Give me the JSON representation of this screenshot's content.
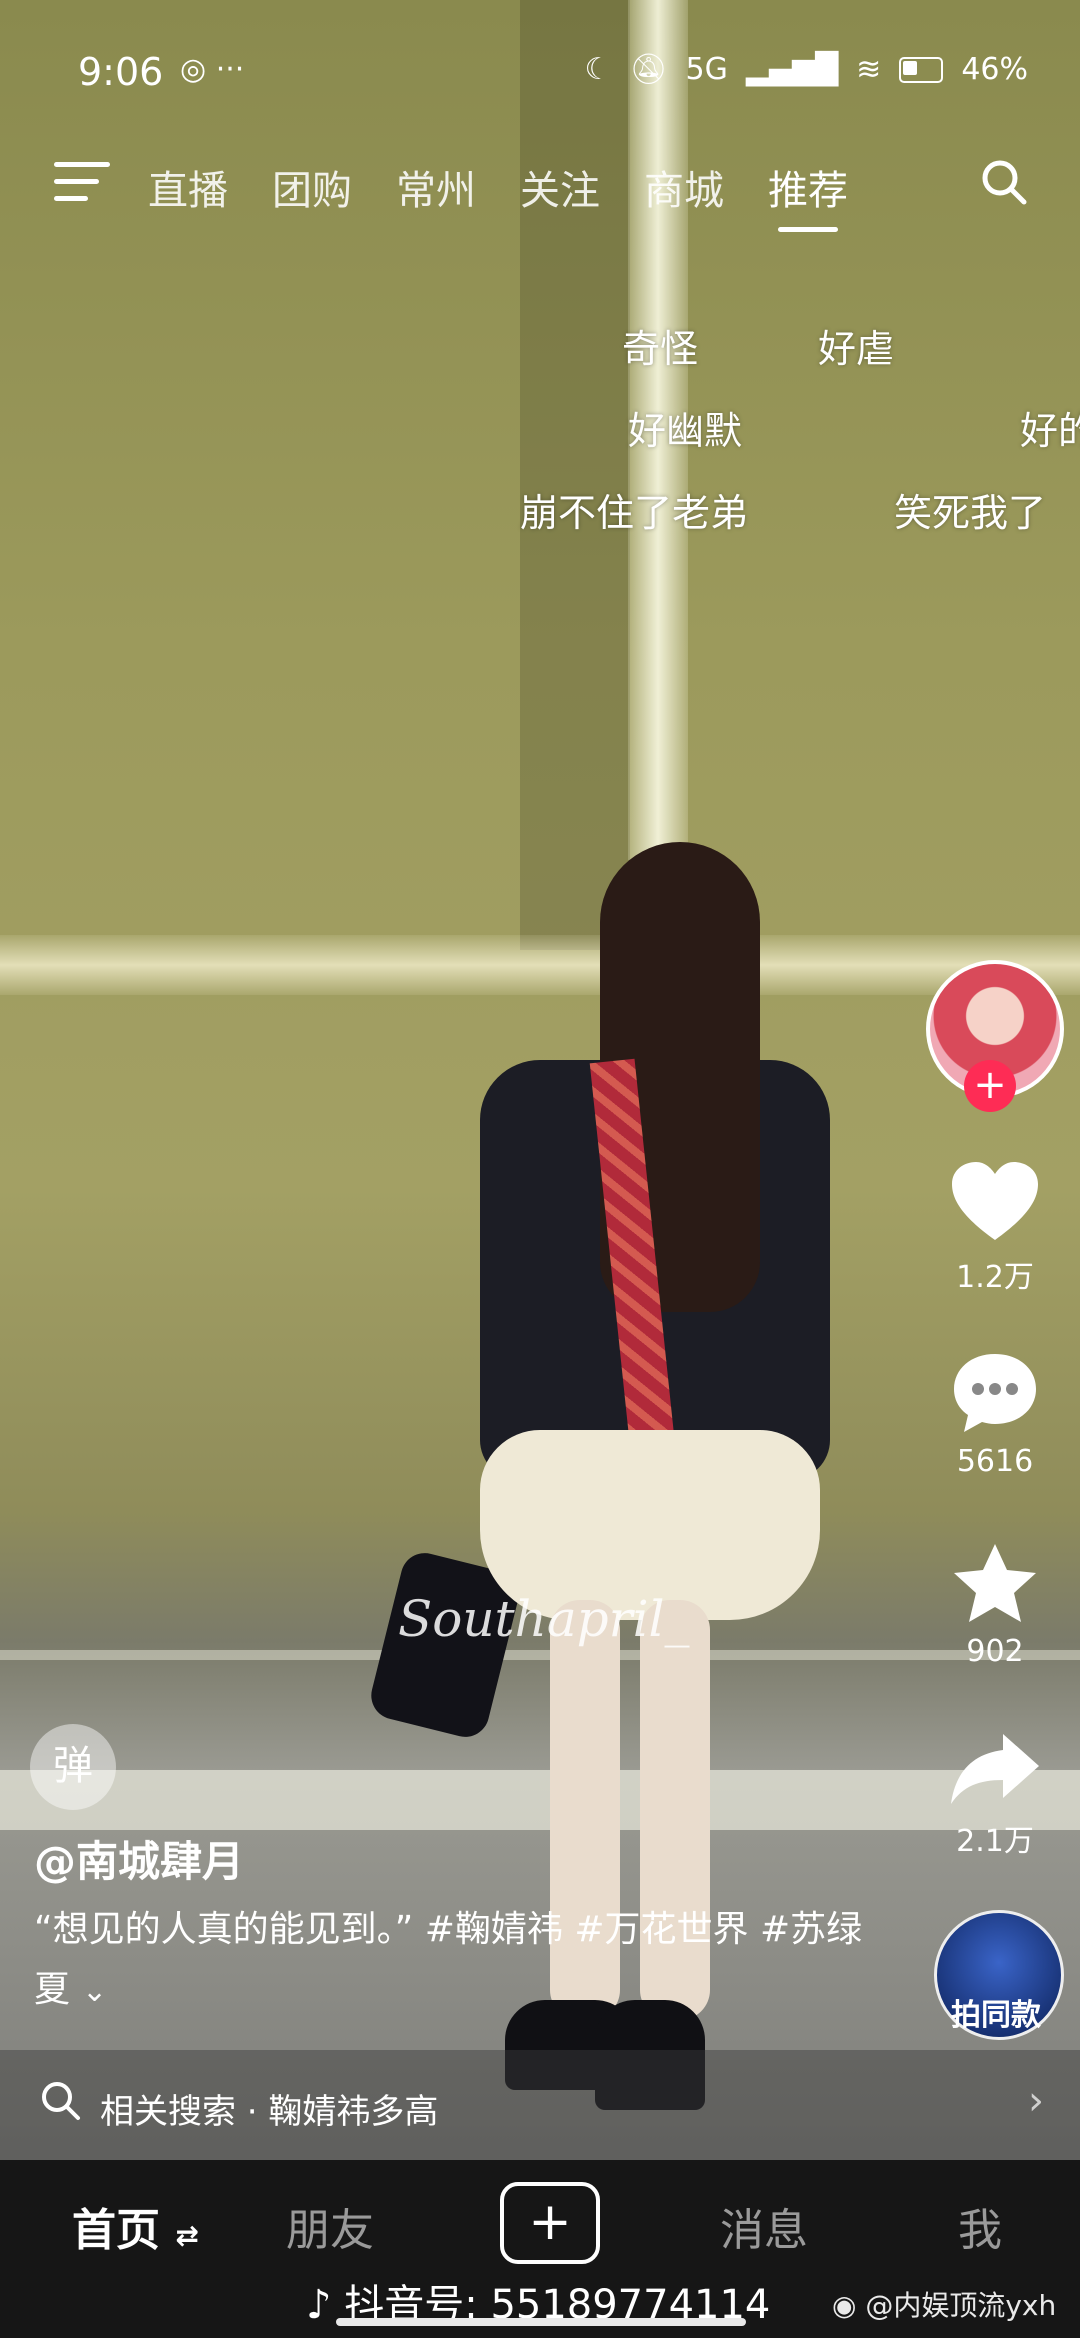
{
  "status_bar": {
    "time": "9:06",
    "left_icons": "◎ ···",
    "signal": "5G",
    "battery": "46%"
  },
  "top_nav": {
    "tabs": [
      "直播",
      "团购",
      "常州",
      "关注",
      "商城",
      "推荐"
    ],
    "active_tab": "推荐"
  },
  "danmaku": [
    {
      "text": "奇怪"
    },
    {
      "text": "好虐"
    },
    {
      "text": "好幽默"
    },
    {
      "text": "好的"
    },
    {
      "text": "崩不住了老弟"
    },
    {
      "text": "笑死我了"
    }
  ],
  "video": {
    "watermark": "Southapril_"
  },
  "right_rail": {
    "likes": "1.2万",
    "comments": "5616",
    "favorites": "902",
    "shares": "2.1万",
    "same_style_label": "拍同款"
  },
  "bullet_toggle": "弹",
  "post": {
    "author": "@南城肆月",
    "caption": "“想见的人真的能见到。” #鞠婧祎 #万花世界 #苏绿夏"
  },
  "related_search": {
    "label": "相关搜索 · 鞠婧祎多高"
  },
  "bottom_nav": {
    "home": "首页",
    "friends": "朋友",
    "messages": "消息",
    "me": "我"
  },
  "overlay": {
    "douyin_id": "抖音号: 55189774114",
    "weibo_credit": "@内娱顶流yxh"
  },
  "colors": {
    "accent_red": "#fe2c55",
    "nav_bg": "#161616"
  }
}
